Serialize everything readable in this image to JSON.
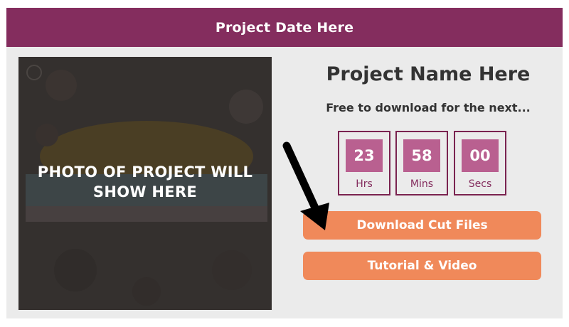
{
  "header": {
    "title": "Project Date Here"
  },
  "photo": {
    "placeholder": "PHOTO OF PROJECT WILL SHOW HERE"
  },
  "project": {
    "name": "Project Name Here",
    "subtitle": "Free to download for the next..."
  },
  "countdown": [
    {
      "value": "23",
      "unit": "Hrs"
    },
    {
      "value": "58",
      "unit": "Mins"
    },
    {
      "value": "00",
      "unit": "Secs"
    }
  ],
  "buttons": {
    "download_label": "Download Cut Files",
    "tutorial_label": "Tutorial & Video"
  },
  "colors": {
    "header": "#842d5e",
    "timer_fill": "#b96090",
    "button": "#f0895a",
    "panel": "#ebebeb"
  },
  "icons": [
    "pointer-arrow-icon"
  ]
}
